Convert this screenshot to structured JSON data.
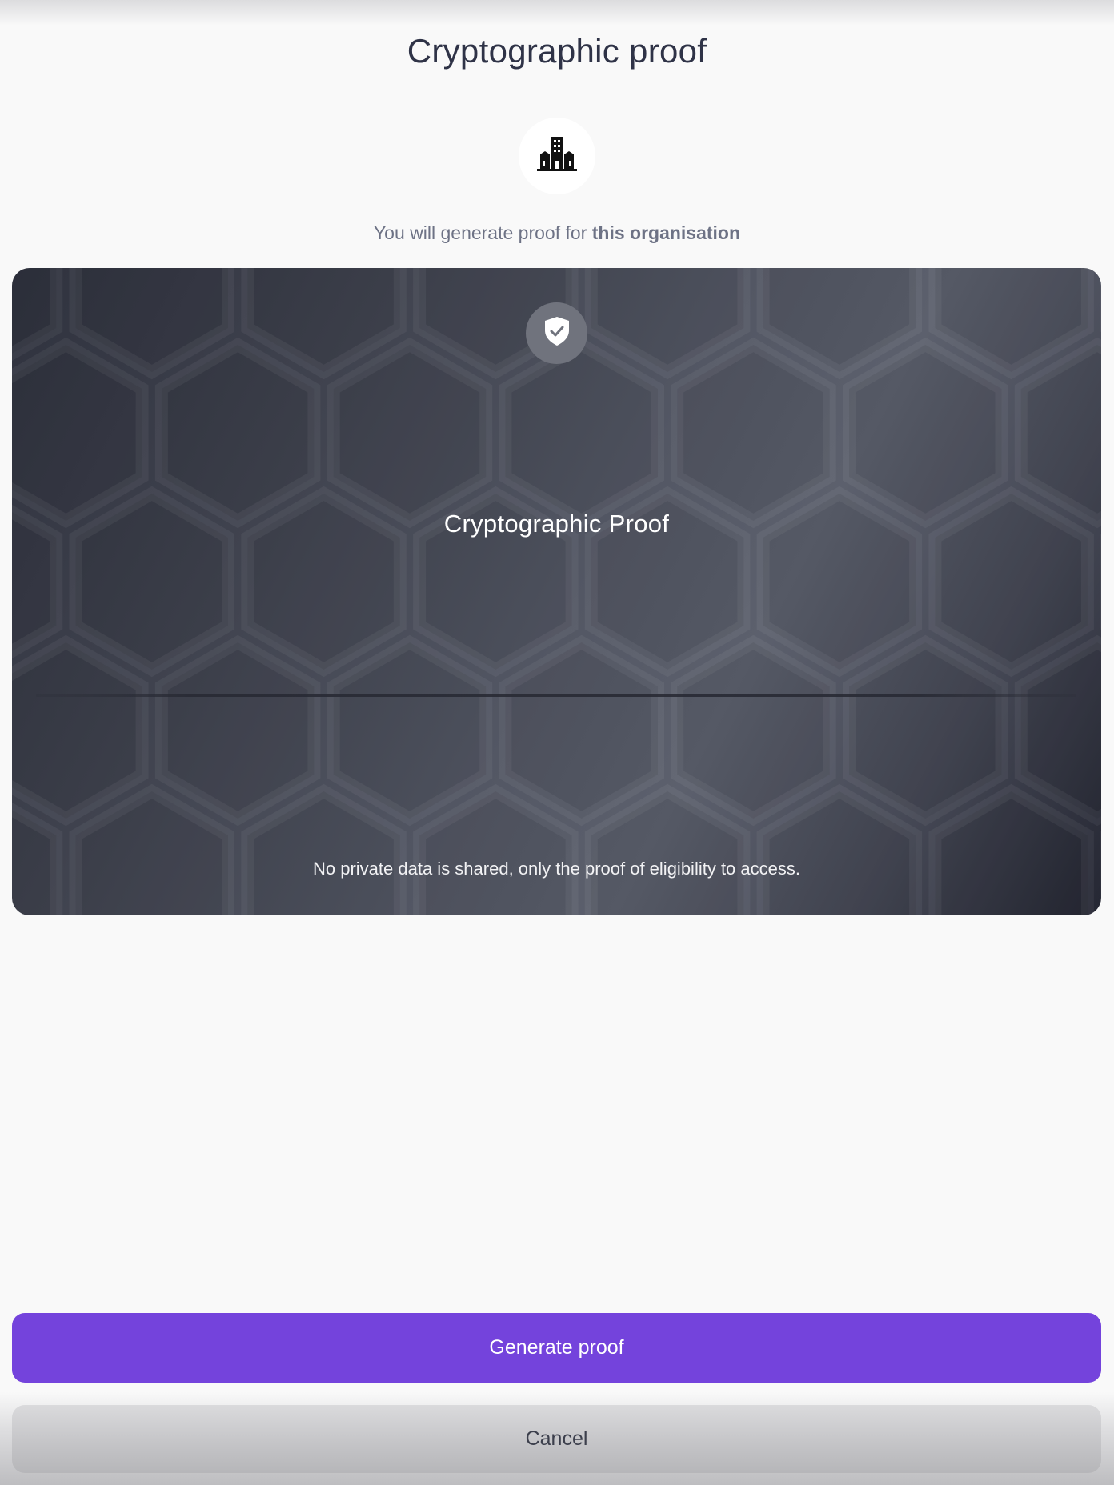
{
  "header": {
    "title": "Cryptographic proof"
  },
  "organisation": {
    "icon": "building-icon",
    "prompt_prefix": "You will generate proof for",
    "prompt_emphasis": "this organisation"
  },
  "proof_card": {
    "icon": "shield-check-icon",
    "title": "Cryptographic Proof",
    "footer": "No private data is shared, only the proof of eligibility to access."
  },
  "actions": {
    "generate_label": "Generate proof",
    "cancel_label": "Cancel"
  },
  "colors": {
    "primary": "#7443dc",
    "background": "#f9f9f9",
    "card_dark": "#2f323e",
    "card_light": "#5c606d",
    "title_text": "#2f3347"
  }
}
